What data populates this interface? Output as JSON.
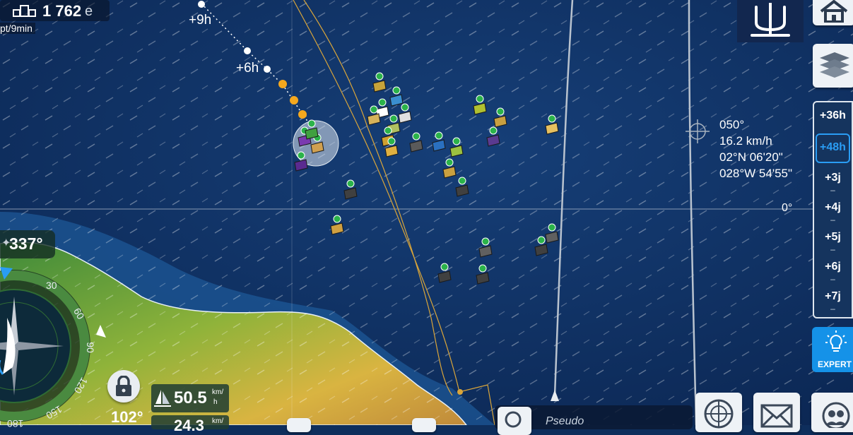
{
  "ranking": {
    "rank": "1 762",
    "suffix": "e",
    "delta": "pt/9min"
  },
  "track_labels": {
    "plus9h": "+9h",
    "plus6h": "+6h"
  },
  "cursor_info": {
    "heading": "050°",
    "speed": "16.2 km/h",
    "lat": "02°N 06'20\"",
    "lon": "028°W 54'55\""
  },
  "equator_label": "0°",
  "timeline": {
    "items": [
      "+36h",
      "+48h",
      "+3j",
      "+4j",
      "+5j",
      "+6j",
      "+7j"
    ],
    "active": "+48h",
    "separator": "–"
  },
  "expert_button": {
    "label": "EXPERT"
  },
  "compass": {
    "wind_direction": "337°",
    "heading": "102°",
    "dial_labels": [
      "30",
      "60",
      "90",
      "120",
      "150",
      "180"
    ]
  },
  "speed_panel": {
    "boat_speed": "50.5",
    "boat_speed_unit_top": "km/",
    "boat_speed_unit_bottom": "h",
    "second_value": "24.3",
    "second_unit": "km/"
  },
  "bottom_bar": {
    "pseudo_label": "Pseudo"
  },
  "colors": {
    "ocean": "#0e2e5c",
    "land": "#7fae3a",
    "accent": "#2a9df4",
    "expert_bg": "#1592e8"
  },
  "icons": [
    "ranking-icon",
    "home-icon",
    "layers-icon",
    "trident-logo-icon",
    "compass-icon",
    "lock-icon",
    "sail-icon",
    "search-icon",
    "radar-icon",
    "mail-icon",
    "players-icon",
    "bulb-icon"
  ]
}
